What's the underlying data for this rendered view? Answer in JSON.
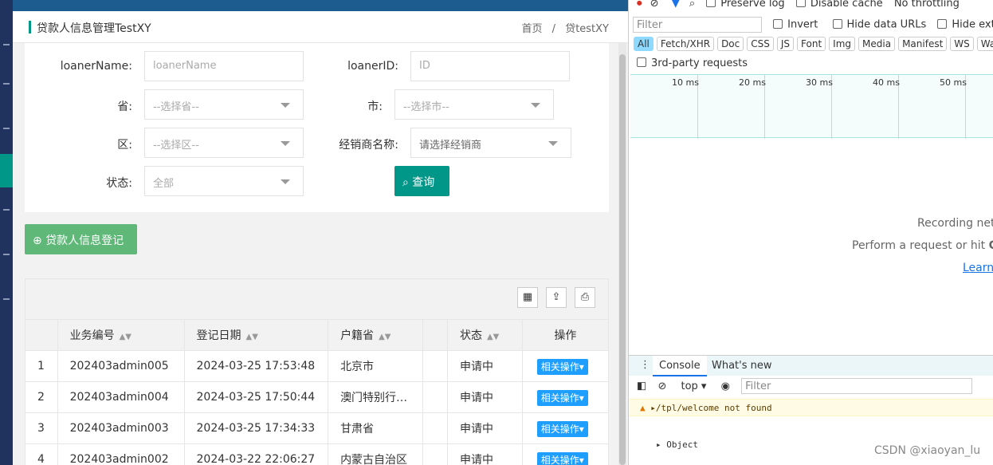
{
  "breadcrumb": {
    "title": "贷款人信息管理TestXY",
    "home": "首页",
    "sep": "/",
    "current": "贷testXY"
  },
  "form": {
    "loanerName_label": "loanerName:",
    "loanerName_placeholder": "loanerName",
    "loanerId_label": "loanerID:",
    "loanerId_placeholder": "ID",
    "province_label": "省:",
    "province_value": "--选择省--",
    "city_label": "市:",
    "city_value": "--选择市--",
    "district_label": "区:",
    "district_value": "--选择区--",
    "dealer_label": "经销商名称:",
    "dealer_value": "请选择经销商",
    "status_label": "状态:",
    "status_value": "全部",
    "query_button": "查询"
  },
  "add_button": "贷款人信息登记",
  "table": {
    "headers": [
      "业务编号",
      "登记日期",
      "户籍省",
      "状态",
      "操作"
    ],
    "rows": [
      {
        "no": "1",
        "id": "202403admin005",
        "date": "2024-03-25 17:53:48",
        "province": "北京市",
        "status": "申请中",
        "op": "相关操作"
      },
      {
        "no": "2",
        "id": "202403admin004",
        "date": "2024-03-25 17:50:44",
        "province": "澳门特别行…",
        "status": "申请中",
        "op": "相关操作"
      },
      {
        "no": "3",
        "id": "202403admin003",
        "date": "2024-03-25 17:34:33",
        "province": "甘肃省",
        "status": "申请中",
        "op": "相关操作"
      },
      {
        "no": "4",
        "id": "202403admin002",
        "date": "2024-03-22 22:06:27",
        "province": "内蒙古自治区",
        "status": "申请中",
        "op": "相关操作"
      }
    ]
  },
  "devtools": {
    "preserve_log": "Preserve log",
    "disable_cache": "Disable cache",
    "throttling": "No throttling",
    "filter_placeholder": "Filter",
    "invert": "Invert",
    "hide_data_urls": "Hide data URLs",
    "hide_ext": "Hide exten",
    "types": [
      "All",
      "Fetch/XHR",
      "Doc",
      "CSS",
      "JS",
      "Font",
      "Img",
      "Media",
      "Manifest",
      "WS",
      "Was"
    ],
    "third_party": "3rd-party requests",
    "ticks": [
      "10 ms",
      "20 ms",
      "30 ms",
      "40 ms",
      "50 ms"
    ],
    "recording": "Recording net",
    "perform": "Perform a request or hit",
    "perform_key": "Ct",
    "learn": "Learn",
    "console_tab": "Console",
    "whatsnew_tab": "What's new",
    "context": "top",
    "console_filter": "Filter",
    "warning": "/tpl/welcome not found",
    "object": "Object"
  },
  "watermark": "CSDN @xiaoyan_lu"
}
